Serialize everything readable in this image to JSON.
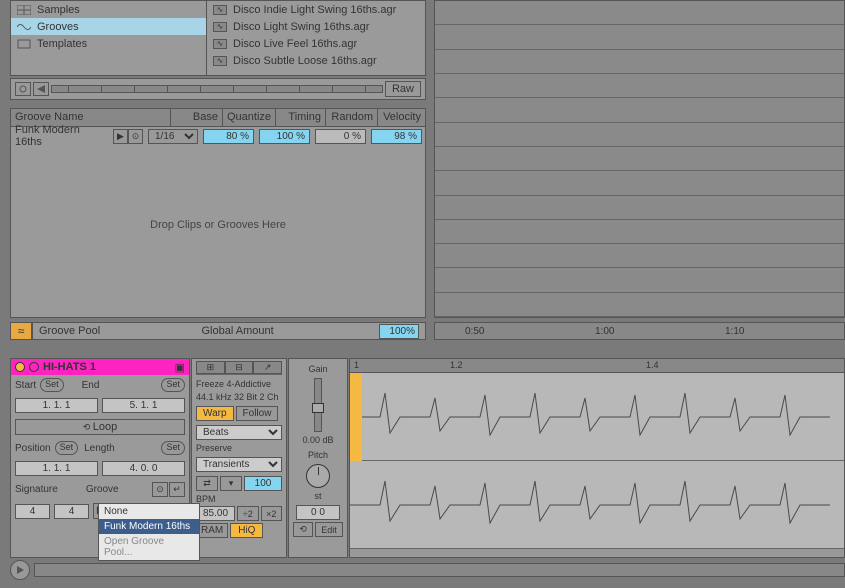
{
  "browser": {
    "sidebar": [
      {
        "label": "Samples",
        "icon": "grid"
      },
      {
        "label": "Grooves",
        "icon": "wave",
        "selected": true
      },
      {
        "label": "Templates",
        "icon": "box"
      }
    ],
    "files": [
      "Disco Indie Light Swing 16ths.agr",
      "Disco Light Swing 16ths.agr",
      "Disco Live Feel 16ths.agr",
      "Disco Subtle Loose 16ths.agr"
    ],
    "raw_label": "Raw"
  },
  "groove_pool": {
    "headers": [
      "Groove Name",
      "Base",
      "Quantize",
      "Timing",
      "Random",
      "Velocity"
    ],
    "row": {
      "name": "Funk Modern 16ths",
      "base": "1/16",
      "quantize": "80 %",
      "timing": "100 %",
      "random": "0 %",
      "velocity": "98 %"
    },
    "drop_text": "Drop Clips or Grooves Here",
    "footer_label": "Groove Pool",
    "global_label": "Global Amount",
    "global_value": "100%"
  },
  "arrange_ruler": [
    "0:50",
    "1:00",
    "1:10"
  ],
  "clip": {
    "name": "HI-HATS 1",
    "start_label": "Start",
    "end_label": "End",
    "set_label": "Set",
    "start_val": "1.   1.   1",
    "end_val": "5.   1.   1",
    "loop_label": "Loop",
    "pos_label": "Position",
    "len_label": "Length",
    "pos_val": "1.   1.   1",
    "len_val": "4.   0.   0",
    "sig_label": "Signature",
    "groove_label": "Groove",
    "sig_num": "4",
    "sig_den": "4",
    "groove_val": "Funk Modern"
  },
  "sample": {
    "freeze_line": "Freeze 4-Addictive",
    "info_line": "44.1 kHz   32 Bit   2 Ch",
    "warp_label": "Warp",
    "follow_label": "Follow",
    "warp_mode": "Beats",
    "preserve_label": "Preserve",
    "preserve_mode": "Transients",
    "gran_val": "100",
    "bpm_label": "BPM",
    "bpm_val": "85.00",
    "half": "÷2",
    "dbl": "×2",
    "ram_label": "RAM",
    "hiq_label": "HiQ"
  },
  "gain": {
    "gain_label": "Gain",
    "db_label": "0.00 dB",
    "pitch_label": "Pitch",
    "st_label": "st",
    "transpose": "0     0",
    "rev": "⟲",
    "edit": "Edit"
  },
  "wave_ruler": [
    "1",
    "1.2",
    "1.4"
  ],
  "dropdown": {
    "items": [
      {
        "label": "None"
      },
      {
        "label": "Funk Modern 16ths",
        "selected": true
      },
      {
        "label": "Open Groove Pool...",
        "dim": true
      }
    ]
  }
}
